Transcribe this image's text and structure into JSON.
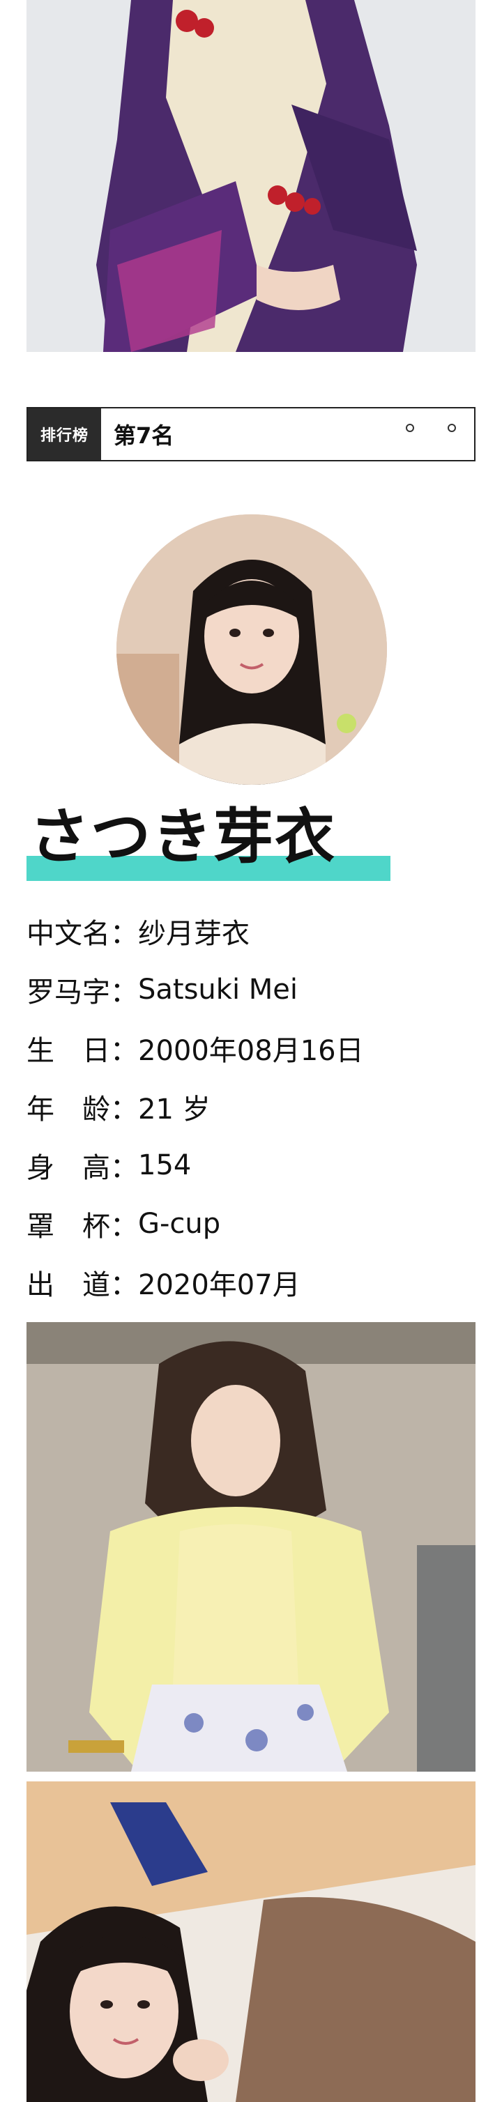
{
  "ranking": {
    "tag": "排行榜",
    "value": "第7名",
    "pager": [
      "prev-dot-icon",
      "next-dot-icon"
    ]
  },
  "idol": {
    "name_jp": "さつき芽衣",
    "accent_color": "#4fd6c9"
  },
  "profile": [
    {
      "label": "中文名：",
      "value": "纱月芽衣"
    },
    {
      "label": "罗马字：",
      "value": "Satsuki Mei"
    },
    {
      "label": "生　日：",
      "value": "2000年08月16日"
    },
    {
      "label": "年　龄：",
      "value": "21 岁"
    },
    {
      "label": "身　高：",
      "value": "154"
    },
    {
      "label": "罩　杯：",
      "value": "G-cup"
    },
    {
      "label": "出　道：",
      "value": "2020年07月"
    }
  ],
  "images": {
    "top_photo": "kimono-photo",
    "avatar": "portrait-avatar",
    "mid_photo": "yellow-cardigan-photo",
    "bottom_photo": "lying-portrait-photo"
  }
}
